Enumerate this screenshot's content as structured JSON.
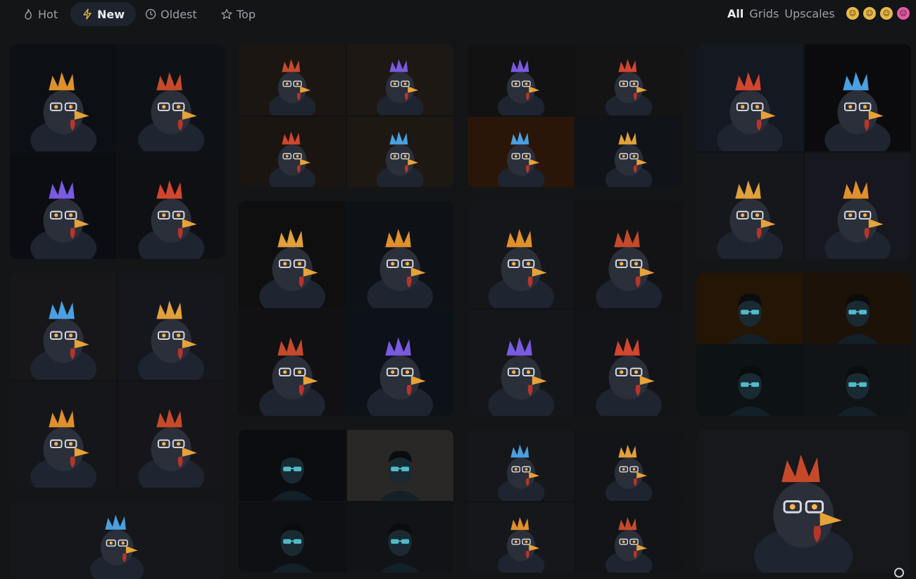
{
  "tabs": [
    {
      "label": "Hot",
      "icon": "flame-icon"
    },
    {
      "label": "New",
      "icon": "bolt-icon"
    },
    {
      "label": "Oldest",
      "icon": "clock-icon"
    },
    {
      "label": "Top",
      "icon": "star-icon"
    }
  ],
  "active_tab": "New",
  "filters": {
    "all": "All",
    "grids": "Grids",
    "upscales": "Upscales"
  },
  "active_filter": "All",
  "reactions": [
    "grin-emoji",
    "cool-emoji",
    "laugh-emoji",
    "devil-emoji"
  ],
  "colors": {
    "background": "#141517",
    "active_tab_bg": "#1d2430",
    "text_active": "#e9ecf0",
    "text_muted": "#9aa0a8"
  },
  "gallery": {
    "cards": [
      {
        "kind": "grid",
        "subject": "rooster-glasses",
        "palette": [
          "#0c0f14",
          "#0e1116",
          "#0c0d12",
          "#0f1014"
        ]
      },
      {
        "kind": "grid",
        "subject": "rooster-glasses",
        "palette": [
          "#1c1612",
          "#1d1813",
          "#1a1510",
          "#1e1813"
        ]
      },
      {
        "kind": "grid",
        "subject": "rooster-glasses",
        "palette": [
          "#121212",
          "#141414",
          "#2a1608",
          "#101317"
        ]
      },
      {
        "kind": "grid",
        "subject": "rooster-glasses",
        "palette": [
          "#141820",
          "#0b0b0d",
          "#15171b",
          "#17171f"
        ]
      },
      {
        "kind": "grid",
        "subject": "rooster-glasses",
        "palette": [
          "#17171a",
          "#16161d",
          "#15161a",
          "#16161a"
        ]
      },
      {
        "kind": "grid",
        "subject": "rooster-glasses",
        "palette": [
          "#0f0f10",
          "#0e1116",
          "#111013",
          "#0d1218"
        ]
      },
      {
        "kind": "grid",
        "subject": "rooster-glasses",
        "palette": [
          "#15161a",
          "#131315",
          "#15161a",
          "#131417"
        ]
      },
      {
        "kind": "grid",
        "subject": "man-glasses",
        "palette": [
          "#241505",
          "#1d1208",
          "#0d1214",
          "#111417"
        ]
      },
      {
        "kind": "single",
        "subject": "rooster-glasses",
        "palette": [
          "#15171a"
        ]
      },
      {
        "kind": "grid",
        "subject": "man-glasses",
        "palette": [
          "#0b0d10",
          "#2a2826",
          "#0e1014",
          "#111316"
        ]
      },
      {
        "kind": "grid",
        "subject": "rooster-glasses",
        "palette": [
          "#16171b",
          "#131417",
          "#16171b",
          "#131417"
        ]
      },
      {
        "kind": "single",
        "subject": "rooster-glasses",
        "palette": [
          "#16181b"
        ]
      }
    ]
  }
}
